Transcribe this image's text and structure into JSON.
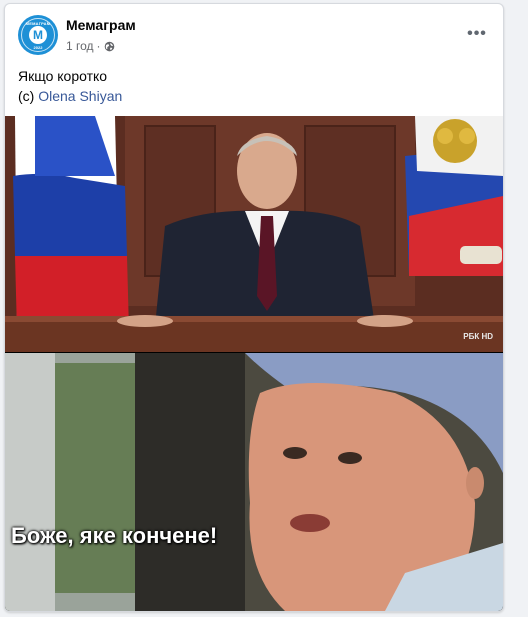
{
  "post": {
    "page_name": "Мемаграм",
    "time": "1 год",
    "separator": "·",
    "privacy_icon": "globe-icon",
    "more_icon": "more-options-icon",
    "more_label": "•••",
    "text": "Якщо коротко",
    "credit_prefix": "(c)",
    "credit_author": "Olena Shiyan"
  },
  "avatar": {
    "top_text": "МЕМАГРАМ",
    "letter": "М",
    "bottom_text": "2022"
  },
  "meme": {
    "top_panel_watermark": "РБК HD",
    "bottom_caption": "Боже, яке кончене!"
  },
  "colors": {
    "link": "#385898",
    "avatar_bg": "#1e90d6",
    "card_bg": "#ffffff",
    "page_bg": "#f0f2f5"
  }
}
